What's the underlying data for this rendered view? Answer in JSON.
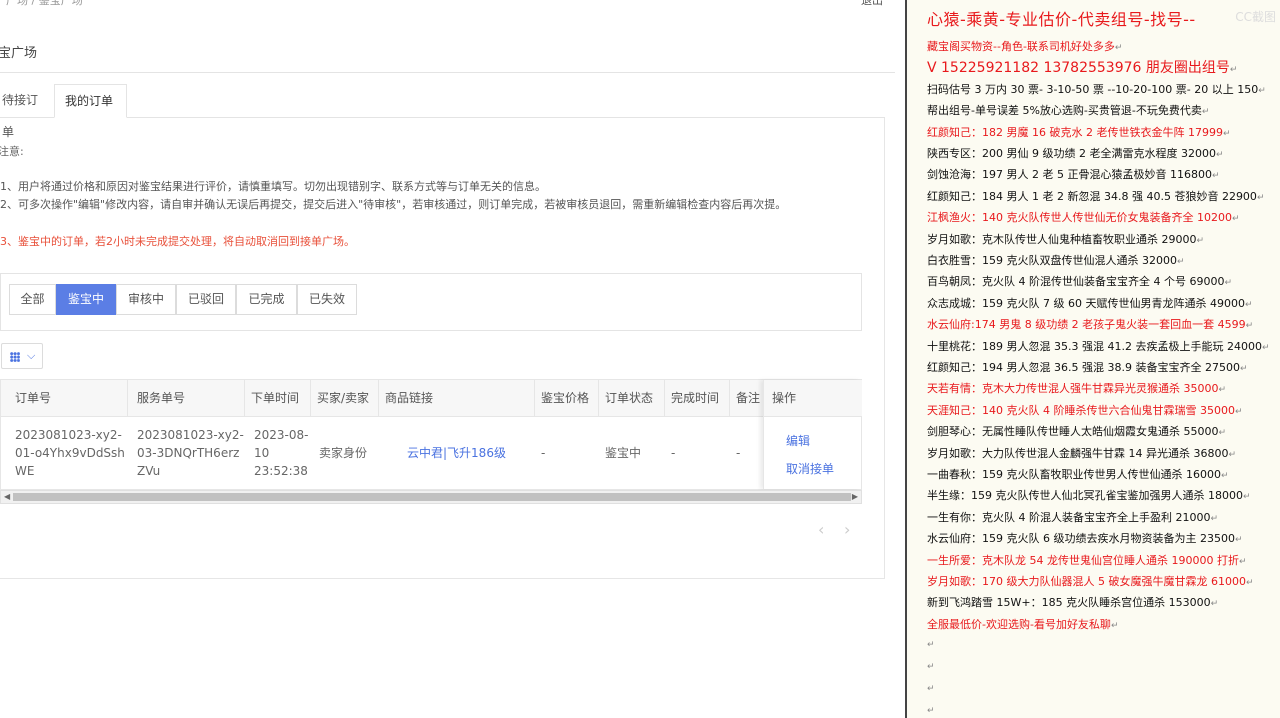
{
  "app": {
    "crumb_left": "广场 / 鉴宝广场",
    "crumb_right": "退出",
    "page_title": "宝广场",
    "tabs": [
      {
        "label": "待接订单"
      },
      {
        "label": "我的订单"
      }
    ],
    "notice": {
      "title": "注意:",
      "line1": "1、用户将通过价格和原因对鉴宝结果进行评价，请慎重填写。切勿出现错别字、联系方式等与订单无关的信息。",
      "line2": "2、可多次操作\"编辑\"修改内容，请自审并确认无误后再提交，提交后进入\"待审核\"，若审核通过，则订单完成，若被审核员退回，需重新编辑检查内容后再次提。",
      "line3": "3、鉴宝中的订单，若2小时未完成提交处理，将自动取消回到接单广场。"
    },
    "filters": [
      {
        "label": "全部"
      },
      {
        "label": "鉴宝中"
      },
      {
        "label": "审核中"
      },
      {
        "label": "已驳回"
      },
      {
        "label": "已完成"
      },
      {
        "label": "已失效"
      }
    ],
    "active_filter": "鉴宝中",
    "table": {
      "headers": [
        "订单号",
        "服务单号",
        "下单时间",
        "买家/卖家",
        "商品链接",
        "鉴宝价格",
        "订单状态",
        "完成时间",
        "备注",
        "操作"
      ],
      "row": {
        "order_no": "2023081023-xy2-01-o4Yhx9vDdSshWE",
        "service_no": "2023081023-xy2-03-3DNQrTH6erzZVu",
        "order_time": "2023-08-10 23:52:38",
        "role": "卖家身份",
        "goods_link": "云中君|飞升186级",
        "price": "-",
        "status": "鉴宝中",
        "done_time": "-",
        "remark": "-",
        "edit": "编辑",
        "cancel": "取消接单"
      }
    },
    "pager": {
      "prev": "‹",
      "next": "›"
    }
  },
  "ad": {
    "title": "心猿-乘黄-专业估价-代卖组号-找号--",
    "watermark": "CC截图",
    "lines": [
      {
        "text": "藏宝阁买物资--角色-联系司机好处多多",
        "red": true
      },
      {
        "text": "V 15225921182    13782553976 朋友圈出组号",
        "red": true,
        "big": true
      },
      {
        "text": "扫码估号 3 万内 30 票- 3-10-50 票  --10-20-100 票- 20 以上 150",
        "red": false
      },
      {
        "text": "帮出组号-单号误差 5%放心选购-买贵管退-不玩免费代卖",
        "red": false
      },
      {
        "text": "红颜知己：182 男魔 16 破克水 2 老传世铁衣金牛阵 17999",
        "red": true
      },
      {
        "text": "陕西专区：200 男仙 9 级功绩 2 老全满雷克水程度 32000",
        "red": false
      },
      {
        "text": "剑蚀沧海：197 男人 2 老 5 正骨混心猿孟极妙音 116800",
        "red": false
      },
      {
        "text": "红颜知己：184 男人 1 老 2 新忽混 34.8 强 40.5 苍狼妙音 22900",
        "red": false
      },
      {
        "text": "江枫渔火：140 克火队传世人传世仙无价女鬼装备齐全 10200",
        "red": true
      },
      {
        "text": "岁月如歌：克木队传世人仙鬼种植畜牧职业通杀 29000",
        "red": false
      },
      {
        "text": "白衣胜雪：159 克火队双盘传世仙混人通杀 32000",
        "red": false
      },
      {
        "text": "百鸟朝凤：克火队 4 阶混传世仙装备宝宝齐全 4 个号 69000",
        "red": false
      },
      {
        "text": "众志成城：159 克火队 7 级 60 天赋传世仙男青龙阵通杀 49000",
        "red": false
      },
      {
        "text": "水云仙府:174 男鬼 8 级功绩 2 老孩子鬼火装一套回血一套 4599",
        "red": true
      },
      {
        "text": "十里桃花：189 男人忽混 35.3 强混 41.2 去疾孟极上手能玩 24000",
        "red": false
      },
      {
        "text": "红颜知己：194 男人忽混 36.5 强混 38.9 装备宝宝齐全 27500",
        "red": false
      },
      {
        "text": "天若有情：克木大力传世混人强牛甘霖异光灵猴通杀 35000",
        "red": true
      },
      {
        "text": "天涯知己：140 克火队 4 阶睡杀传世六合仙鬼甘霖瑞雪 35000",
        "red": true
      },
      {
        "text": "剑胆琴心：无属性睡队传世睡人太皓仙烟霞女鬼通杀 55000",
        "red": false
      },
      {
        "text": "岁月如歌：大力队传世混人金麟强牛甘霖 14 异光通杀 36800",
        "red": false
      },
      {
        "text": "一曲春秋：159 克火队畜牧职业传世男人传世仙通杀 16000",
        "red": false
      },
      {
        "text": "半生缘：159 克火队传世人仙北冥孔雀宝鉴加强男人通杀 18000",
        "red": false
      },
      {
        "text": "一生有你：克火队 4 阶混人装备宝宝齐全上手盈利 21000",
        "red": false
      },
      {
        "text": "水云仙府：159 克火队 6 级功绩去疾水月物资装备为主 23500",
        "red": false
      },
      {
        "text": "一生所爱：克木队龙 54 龙传世鬼仙宫位睡人通杀 190000 打折",
        "red": true
      },
      {
        "text": "岁月如歌：170 级大力队仙器混人 5 破女魔强牛魔甘霖龙 61000",
        "red": true
      },
      {
        "text": "新到飞鸿踏雪 15W+：185 克火队睡杀宫位通杀 153000",
        "red": false
      },
      {
        "text": "全服最低价-欢迎选购-看号加好友私聊",
        "red": true
      }
    ],
    "paragraph_marks": [
      "↵",
      "↵",
      "↵",
      "↵"
    ]
  }
}
